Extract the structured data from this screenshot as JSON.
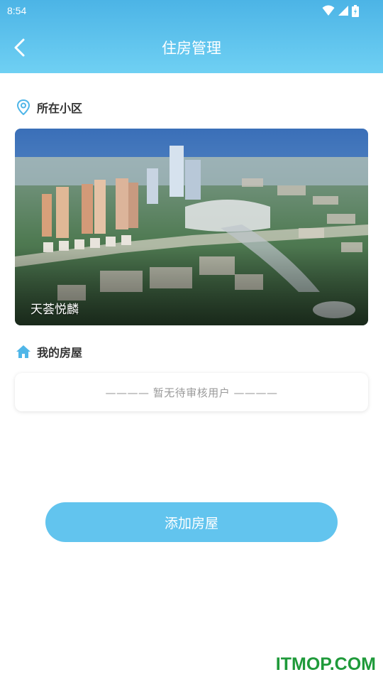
{
  "status_bar": {
    "time": "8:54"
  },
  "header": {
    "title": "住房管理"
  },
  "community_section": {
    "title": "所在小区",
    "community_name": "天荟悦麟"
  },
  "house_section": {
    "title": "我的房屋",
    "empty_text": "———— 暂无待审核用户 ————"
  },
  "actions": {
    "add_house": "添加房屋"
  },
  "watermark": "ITMOP.COM",
  "colors": {
    "header_top": "#4cb4e6",
    "header_bottom": "#6fd0f3",
    "accent": "#62c4ee",
    "watermark": "#1f9a3a"
  },
  "icons": [
    "wifi-icon",
    "signal-icon",
    "battery-icon",
    "back-arrow-icon",
    "location-pin-icon",
    "home-icon"
  ]
}
